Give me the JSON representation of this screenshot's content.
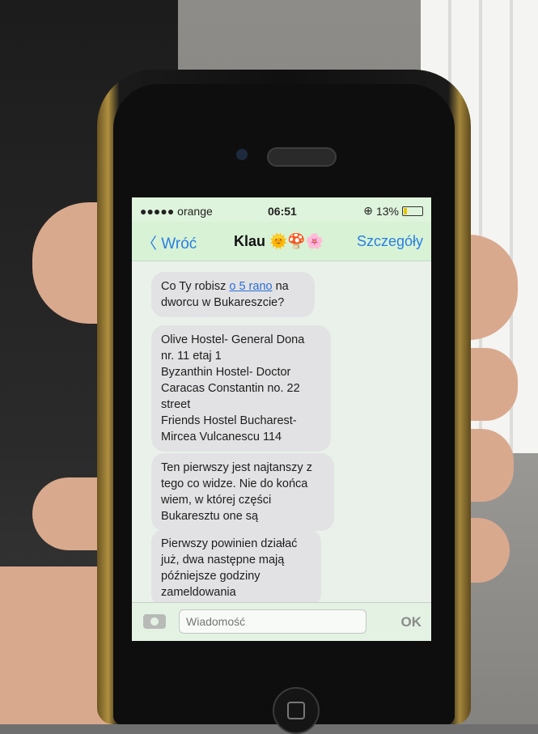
{
  "status_bar": {
    "carrier": "●●●●● orange",
    "time": "06:51",
    "battery": "13%"
  },
  "nav": {
    "back_label": "Wróć",
    "contact_name": "Klau 🌞🍄🌸",
    "details_label": "Szczegóły"
  },
  "messages": [
    {
      "text_before": "Co Ty robisz ",
      "link": "o 5 rano",
      "text_after": " na dworcu w Bukareszcie?"
    },
    {
      "lines": [
        "Olive Hostel- General Dona",
        "nr. 11 etaj 1",
        "Byzanthin Hostel- Doctor",
        "Caracas Constantin no. 22",
        "street",
        "Friends Hostel Bucharest-",
        "Mircea Vulcanescu 114"
      ]
    },
    {
      "text": "Ten pierwszy jest najtanszy z tego co widze. Nie do końca wiem, w której części Bukaresztu one są"
    },
    {
      "text": "Pierwszy powinien działać już, dwa następne mają późniejsze godziny zameldowania"
    }
  ],
  "composer": {
    "placeholder": "Wiadomość",
    "send_label": "OK"
  },
  "colors": {
    "link_blue": "#2a7fe0",
    "bubble_gray": "#e2e2e4",
    "battery_yellow": "#e8c400"
  }
}
